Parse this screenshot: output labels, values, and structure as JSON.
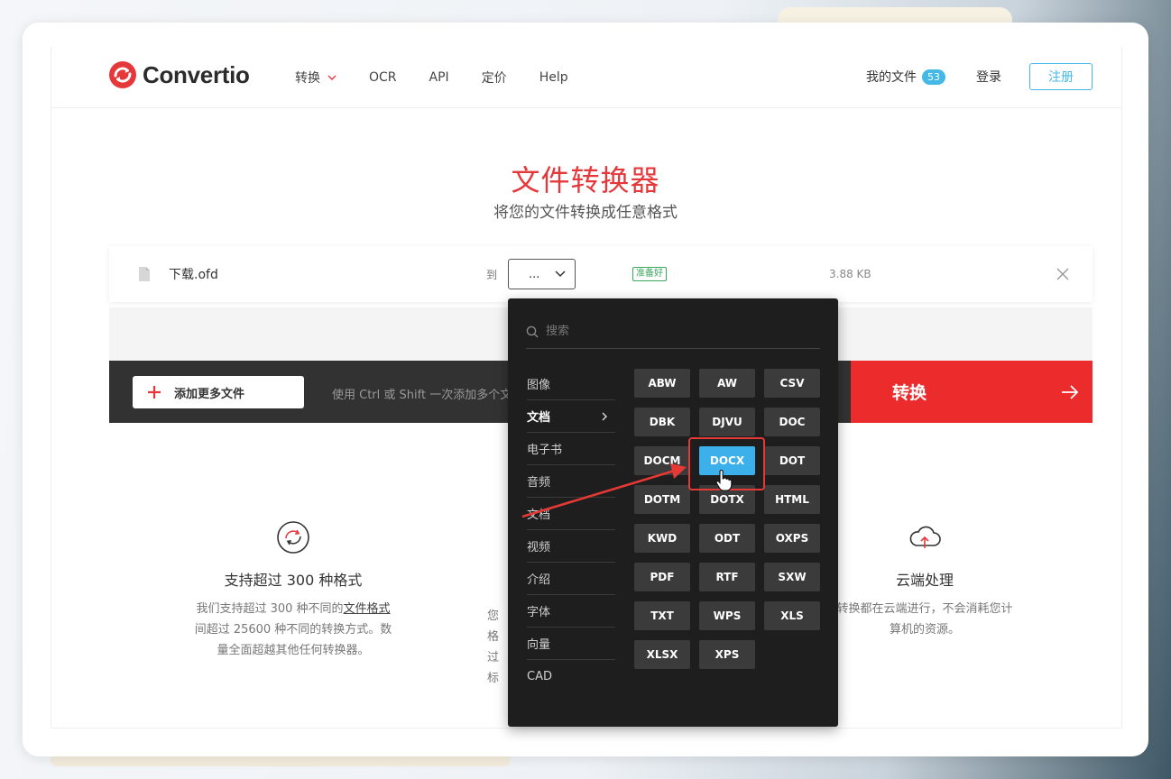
{
  "brand": {
    "name": "Convertio"
  },
  "nav": {
    "items": [
      {
        "label": "转换",
        "has_dropdown": true
      },
      {
        "label": "OCR"
      },
      {
        "label": "API"
      },
      {
        "label": "定价"
      },
      {
        "label": "Help"
      }
    ],
    "my_files_label": "我的文件",
    "my_files_count": "53",
    "login_label": "登录",
    "signup_label": "注册"
  },
  "hero": {
    "title": "文件转换器",
    "subtitle": "将您的文件转换成任意格式"
  },
  "file": {
    "name": "下载.ofd",
    "to_label": "到",
    "selected_format": "...",
    "status": "准备好",
    "size": "3.88 KB"
  },
  "actions": {
    "add_more_label": "添加更多文件",
    "hint": "使用 Ctrl 或 Shift 一次添加多个文",
    "convert_label": "转换"
  },
  "dropdown": {
    "search_placeholder": "搜索",
    "categories": [
      {
        "label": "图像"
      },
      {
        "label": "文档",
        "active": true
      },
      {
        "label": "电子书"
      },
      {
        "label": "音频"
      },
      {
        "label": "文档"
      },
      {
        "label": "视频"
      },
      {
        "label": "介绍"
      },
      {
        "label": "字体"
      },
      {
        "label": "向量"
      },
      {
        "label": "CAD"
      }
    ],
    "formats": [
      "ABW",
      "AW",
      "CSV",
      "DBK",
      "DJVU",
      "DOC",
      "DOCM",
      "DOCX",
      "DOT",
      "DOTM",
      "DOTX",
      "HTML",
      "KWD",
      "ODT",
      "OXPS",
      "PDF",
      "RTF",
      "SXW",
      "TXT",
      "WPS",
      "XLS",
      "XLSX",
      "XPS"
    ],
    "selected_format": "DOCX"
  },
  "features": [
    {
      "title": "支持超过 300 种格式",
      "desc_lines": [
        "我们支持超过 300 种不同的",
        "文件格式",
        "间超过 25600 种不同的转换方式。数",
        "量全面超越其他任何转换器。"
      ]
    },
    {
      "title": "",
      "desc_lines": [
        "您",
        "格",
        "过",
        "标"
      ]
    },
    {
      "title": "云端处理",
      "desc_lines": [
        "转换都在云端进行，不会消耗您计",
        "算机的资源。"
      ]
    }
  ],
  "colors": {
    "brand_red": "#e5383b",
    "accent_blue": "#44b9e6",
    "convert_red": "#ec2c2c",
    "dropdown_bg": "#1e1e1e",
    "selected_format_bg": "#3cb0ea",
    "annotation_red": "#e53935"
  }
}
